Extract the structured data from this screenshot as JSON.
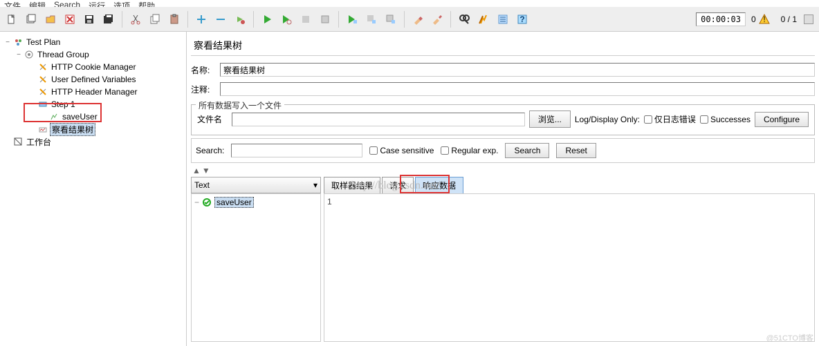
{
  "menubar": [
    "文件",
    "编辑",
    "Search",
    "运行",
    "选项",
    "帮助"
  ],
  "toolbar": {
    "time": "00:00:03",
    "warn_count": "0",
    "pager": "0 / 1"
  },
  "tree": {
    "root": "Test Plan",
    "thread_group": "Thread Group",
    "cookie_mgr": "HTTP Cookie Manager",
    "udv": "User Defined Variables",
    "header_mgr": "HTTP Header Manager",
    "step1": "Step 1",
    "saveuser": "saveUser",
    "result_tree": "察看结果树",
    "workbench": "工作台"
  },
  "panel": {
    "title": "察看结果树",
    "name_label": "名称:",
    "name_value": "察看结果树",
    "comment_label": "注释:",
    "comment_value": ""
  },
  "file_group": {
    "legend": "所有数据写入一个文件",
    "filename_label": "文件名",
    "filename_value": "",
    "browse": "浏览...",
    "logdisplay": "Log/Display Only:",
    "errors_only": "仅日志错误",
    "successes": "Successes",
    "configure": "Configure"
  },
  "search": {
    "label": "Search:",
    "value": "",
    "case_sensitive": "Case sensitive",
    "regexp": "Regular exp.",
    "search_btn": "Search",
    "reset_btn": "Reset"
  },
  "results": {
    "type_selector": "Text",
    "sample": "saveUser",
    "tabs": {
      "sampler": "取样器结果",
      "request": "请求",
      "response": "响应数据"
    },
    "response_body": "1"
  },
  "watermark": "http://blog.csdn.net/",
  "footer": "@51CTO博客"
}
